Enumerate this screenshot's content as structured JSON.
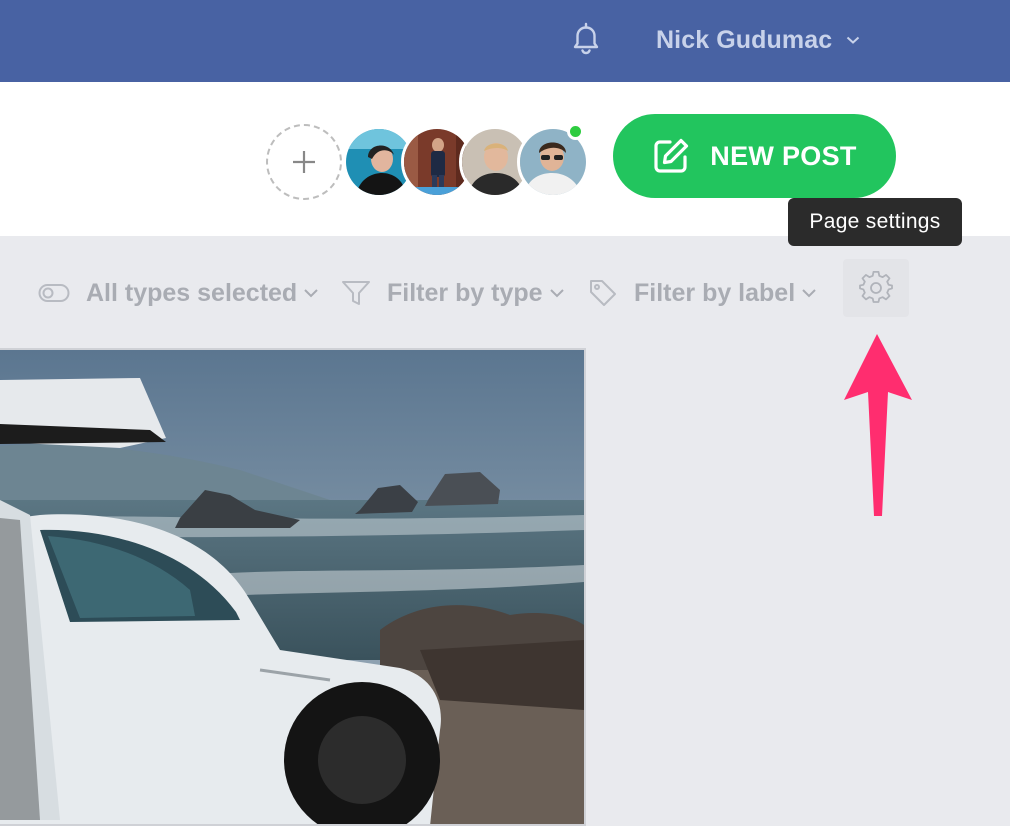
{
  "topbar": {
    "user_name": "Nick Gudumac",
    "icons": [
      "bell-icon",
      "chevron-down-icon"
    ],
    "bg_color": "#4862a3"
  },
  "header": {
    "new_post_label": "NEW POST",
    "new_post_color": "#22c55e",
    "icons": [
      "plus-icon",
      "edit-icon"
    ],
    "avatars": [
      "avatar-1",
      "avatar-2",
      "avatar-3",
      "avatar-4"
    ],
    "online_status_color": "#2ecc40"
  },
  "tooltip": {
    "text": "Page settings"
  },
  "filters": {
    "types_label": "All types selected",
    "type_filter_label": "Filter by type",
    "label_filter_label": "Filter by label",
    "icons": [
      "toggle-icon",
      "funnel-icon",
      "tag-icon",
      "gear-icon"
    ]
  },
  "annotation": {
    "arrow_color": "#ff2d6f"
  }
}
